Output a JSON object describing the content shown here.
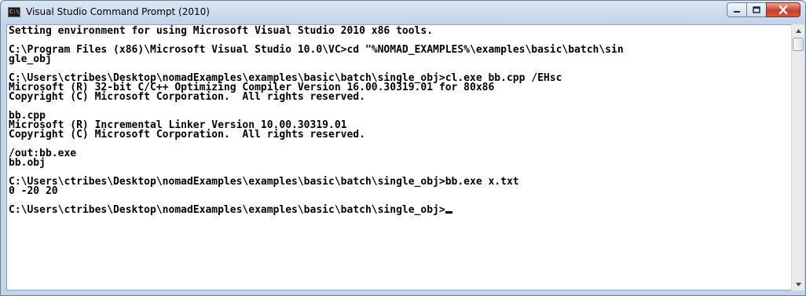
{
  "window": {
    "title": "Visual Studio Command Prompt (2010)",
    "icon": "console-icon",
    "icon_text": "C:\\"
  },
  "controls": {
    "minimize_icon": "minimize-icon",
    "maximize_icon": "maximize-icon",
    "close_icon": "close-icon"
  },
  "console": {
    "lines": [
      "Setting environment for using Microsoft Visual Studio 2010 x86 tools.",
      "",
      "C:\\Program Files (x86)\\Microsoft Visual Studio 10.0\\VC>cd \"%NOMAD_EXAMPLES%\\examples\\basic\\batch\\sin",
      "gle_obj",
      "",
      "C:\\Users\\ctribes\\Desktop\\nomadExamples\\examples\\basic\\batch\\single_obj>cl.exe bb.cpp /EHsc",
      "Microsoft (R) 32-bit C/C++ Optimizing Compiler Version 16.00.30319.01 for 80x86",
      "Copyright (C) Microsoft Corporation.  All rights reserved.",
      "",
      "bb.cpp",
      "Microsoft (R) Incremental Linker Version 10.00.30319.01",
      "Copyright (C) Microsoft Corporation.  All rights reserved.",
      "",
      "/out:bb.exe",
      "bb.obj",
      "",
      "C:\\Users\\ctribes\\Desktop\\nomadExamples\\examples\\basic\\batch\\single_obj>bb.exe x.txt",
      "0 -20 20",
      ""
    ],
    "prompt": "C:\\Users\\ctribes\\Desktop\\nomadExamples\\examples\\basic\\batch\\single_obj>"
  },
  "colors": {
    "console_background": "#ffffff",
    "console_text": "#000000",
    "titlebar": "#c3d4e9",
    "close_button": "#c7412b"
  }
}
